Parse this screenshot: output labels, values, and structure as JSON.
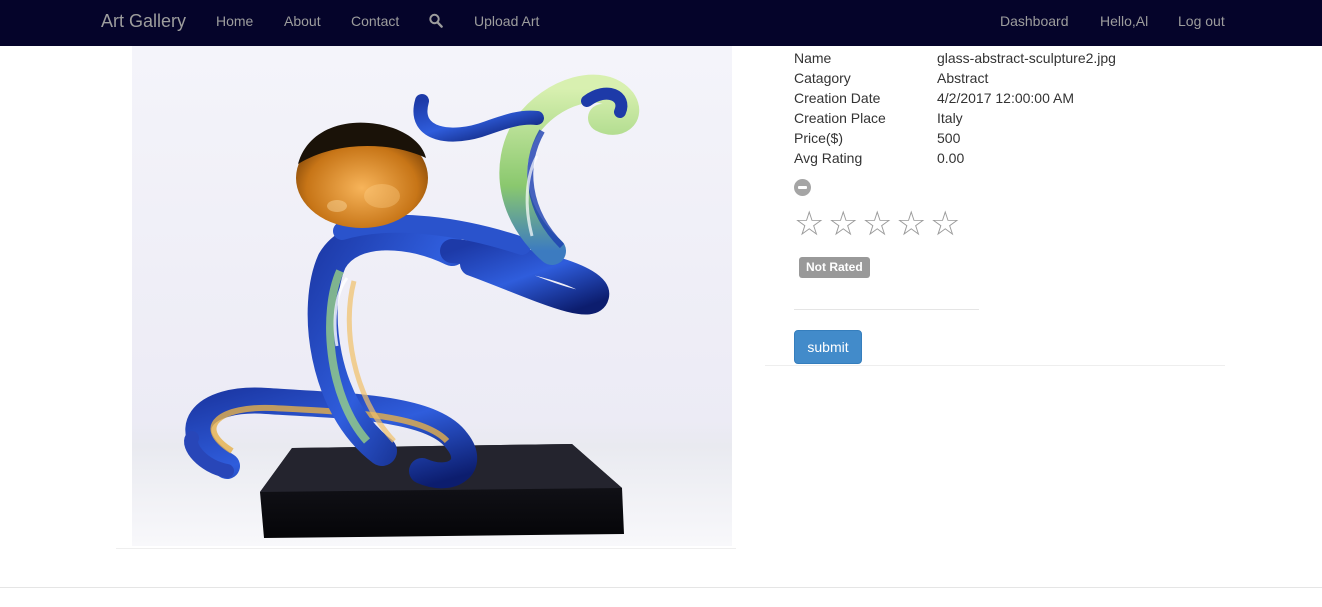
{
  "navbar": {
    "brand": "Art Gallery",
    "left_links": [
      "Home",
      "About",
      "Contact",
      "Upload Art"
    ],
    "search_icon": "search-icon",
    "right_links": [
      "Dashboard",
      "Hello,Al",
      "Log out"
    ]
  },
  "artwork": {
    "subject": "glass abstract sculpture"
  },
  "details": {
    "rows": [
      {
        "label": "Name",
        "value": "glass-abstract-sculpture2.jpg"
      },
      {
        "label": "Catagory",
        "value": "Abstract"
      },
      {
        "label": "Creation Date",
        "value": "4/2/2017 12:00:00 AM"
      },
      {
        "label": "Creation Place",
        "value": "Italy"
      },
      {
        "label": "Price($)",
        "value": "500"
      },
      {
        "label": "Avg Rating",
        "value": "0.00"
      }
    ]
  },
  "rating": {
    "clear_icon": "minus-circle-icon",
    "star_glyph": "☆",
    "stars_total": 5,
    "stars_selected": 0,
    "caption": "Not Rated"
  },
  "form": {
    "submit_label": "submit"
  },
  "colors": {
    "navbar_bg": "#05042a",
    "nav_text": "#9d9d9d",
    "primary_button": "#428bca",
    "badge_bg": "#999999",
    "star": "#9b9b9b"
  }
}
